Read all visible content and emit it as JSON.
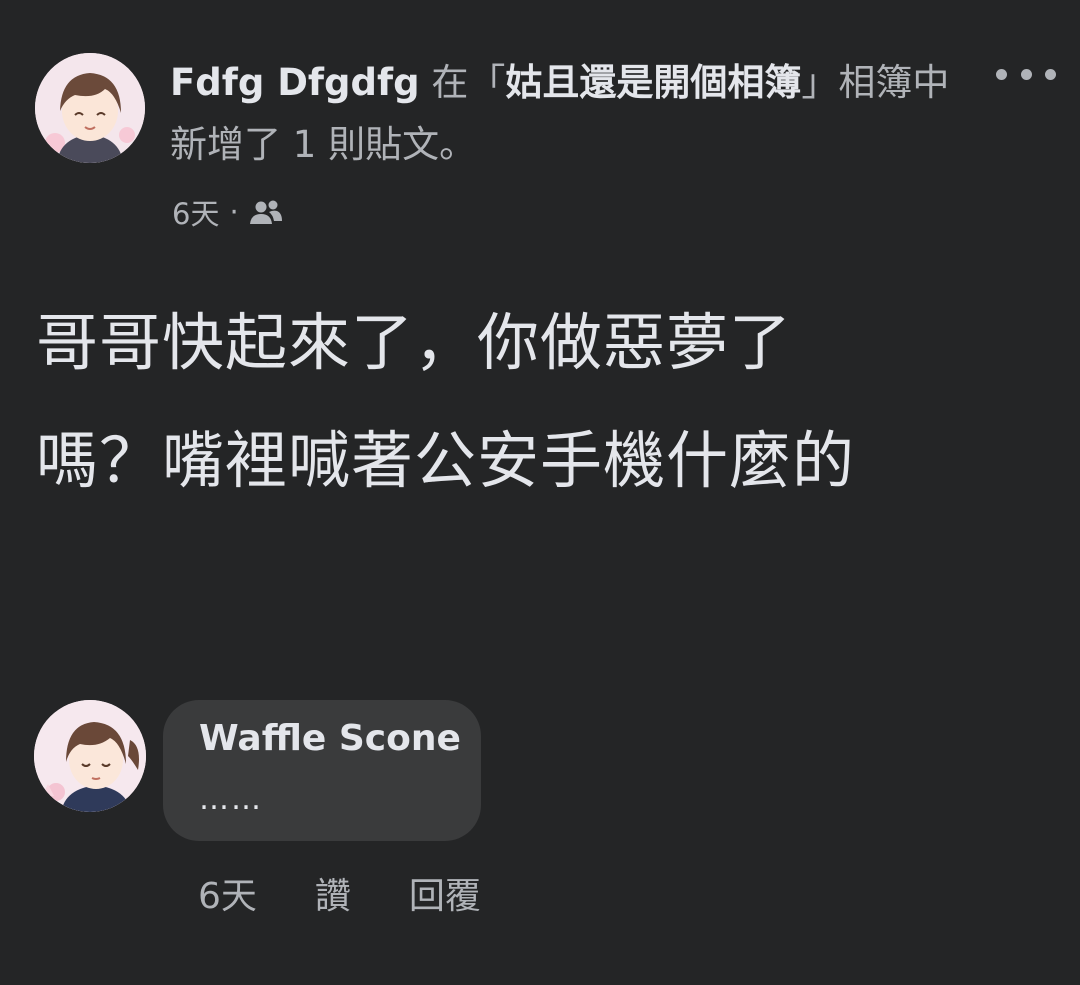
{
  "post": {
    "author": "Fdfg Dfgdfg",
    "action_prefix": " 在「",
    "album_name": "姑且還是開個相簿",
    "action_suffix": "」相簿中新增了 1 則貼文。",
    "timestamp": "6天",
    "separator": "·",
    "audience_icon": "friends-icon",
    "body_line1": "哥哥快起來了，你做惡夢了",
    "body_line2": "嗎？嘴裡喊著公安手機什麼的"
  },
  "comment": {
    "author": "Waffle Scone",
    "text": "……",
    "timestamp": "6天",
    "like_label": "讚",
    "reply_label": "回覆"
  },
  "icons": {
    "more": "more-options-icon"
  },
  "colors": {
    "background": "#242526",
    "bubble": "#3a3b3c",
    "primary_text": "#e4e6eb",
    "secondary_text": "#b0b3b8"
  }
}
